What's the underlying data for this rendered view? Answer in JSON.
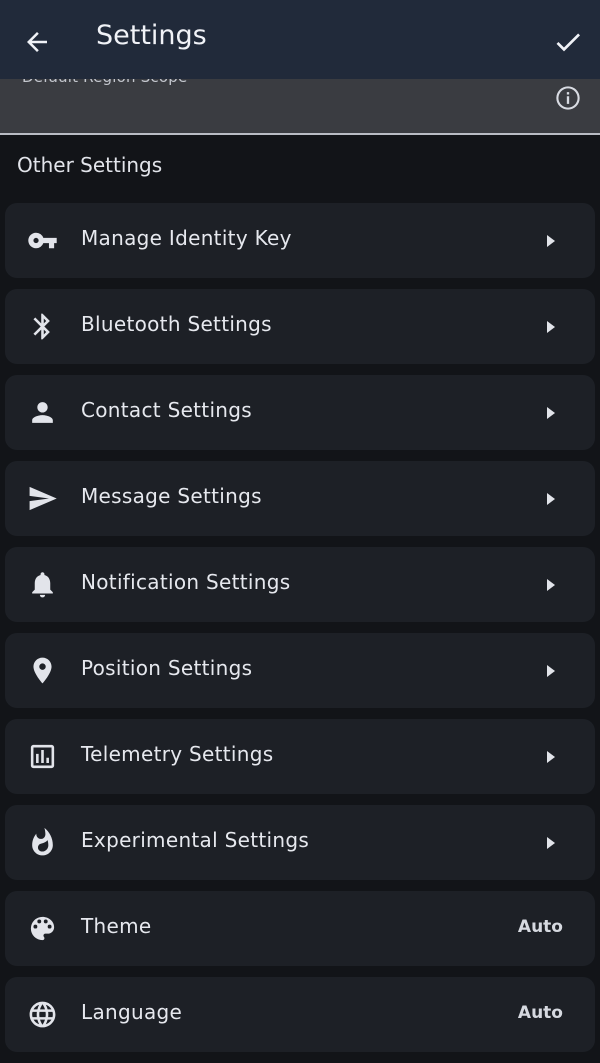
{
  "appbar": {
    "title": "Settings"
  },
  "region": {
    "label": "Default Region Scope"
  },
  "section_title": "Other Settings",
  "items": [
    {
      "label": "Manage Identity Key",
      "icon": "key-icon"
    },
    {
      "label": "Bluetooth Settings",
      "icon": "bluetooth-icon"
    },
    {
      "label": "Contact Settings",
      "icon": "person-icon"
    },
    {
      "label": "Message Settings",
      "icon": "send-icon"
    },
    {
      "label": "Notification Settings",
      "icon": "bell-icon"
    },
    {
      "label": "Position Settings",
      "icon": "location-pin-icon"
    },
    {
      "label": "Telemetry Settings",
      "icon": "bar-chart-icon"
    },
    {
      "label": "Experimental Settings",
      "icon": "flame-icon"
    },
    {
      "label": "Theme",
      "icon": "palette-icon",
      "value": "Auto"
    },
    {
      "label": "Language",
      "icon": "globe-icon",
      "value": "Auto"
    }
  ]
}
